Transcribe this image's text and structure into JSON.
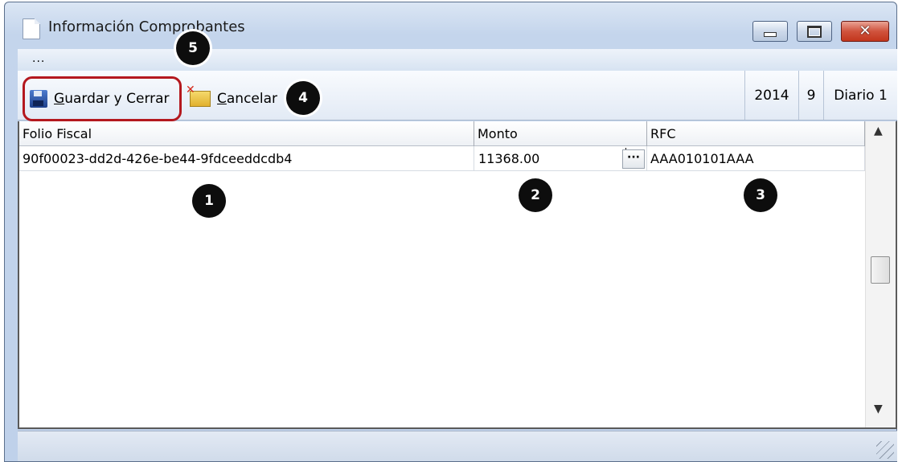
{
  "window": {
    "title": "Información Comprobantes",
    "minimize_glyph": "",
    "close_glyph": "✕"
  },
  "menu": {
    "ellipsis": "..."
  },
  "toolbar": {
    "save_label_first": "G",
    "save_label_rest": "uardar y Cerrar",
    "cancel_label_first": "C",
    "cancel_label_rest": "ancelar",
    "year": "2014",
    "period": "9",
    "diary": "Diario 1"
  },
  "grid": {
    "columns": [
      "Folio Fiscal",
      "Monto",
      "RFC"
    ],
    "rows": [
      {
        "folio_fiscal": "90f00023-dd2d-426e-be44-9fdceeddcdb4",
        "monto": "11368.00",
        "rfc": "AAA010101AAA"
      }
    ],
    "ellipsis_button": "···"
  },
  "callouts": [
    "1",
    "2",
    "3",
    "4",
    "5"
  ],
  "icons": {
    "document": "document-icon",
    "save": "save-icon",
    "cancel": "cancel-icon",
    "minimize": "minimize-icon",
    "maximize": "maximize-icon",
    "close": "close-icon"
  },
  "colors": {
    "highlight": "#b4181e",
    "callout": "#0d0d0d"
  }
}
